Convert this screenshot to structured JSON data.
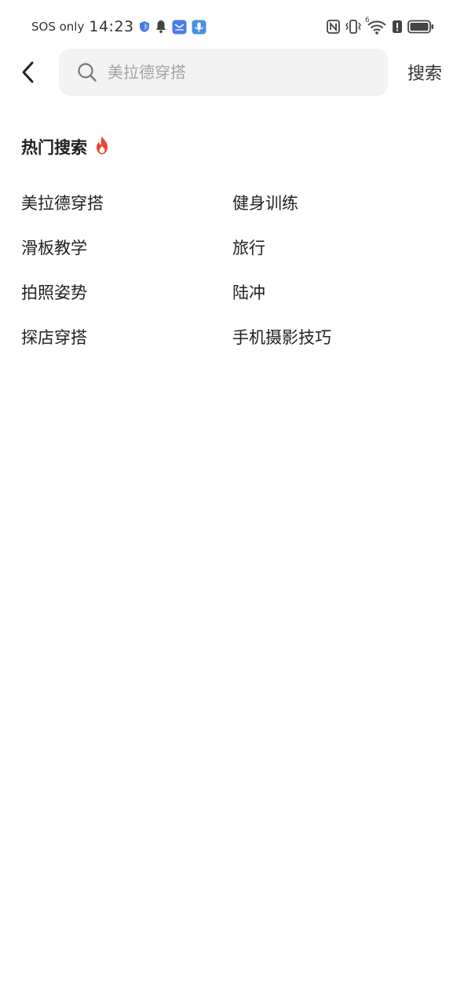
{
  "status_bar": {
    "carrier": "SOS only",
    "time": "14:23",
    "left_icons": [
      "shield-icon",
      "bell-icon",
      "mail-app-icon",
      "microphone-app-icon"
    ],
    "right_icons": [
      "nfc-icon",
      "vibrate-icon",
      "wifi-icon",
      "battery-icon"
    ],
    "wifi_label": "6",
    "colors": {
      "shield": "#4a7bea",
      "mail": "#4a7bea",
      "mic": "#4a90e2"
    }
  },
  "top_bar": {
    "search_placeholder": "美拉德穿搭",
    "search_button": "搜索"
  },
  "hot_search": {
    "title": "热门搜索",
    "flame_color": "#e8463a",
    "items": [
      "美拉德穿搭",
      "健身训练",
      "滑板教学",
      "旅行",
      "拍照姿势",
      "陆冲",
      "探店穿搭",
      "手机摄影技巧"
    ]
  }
}
